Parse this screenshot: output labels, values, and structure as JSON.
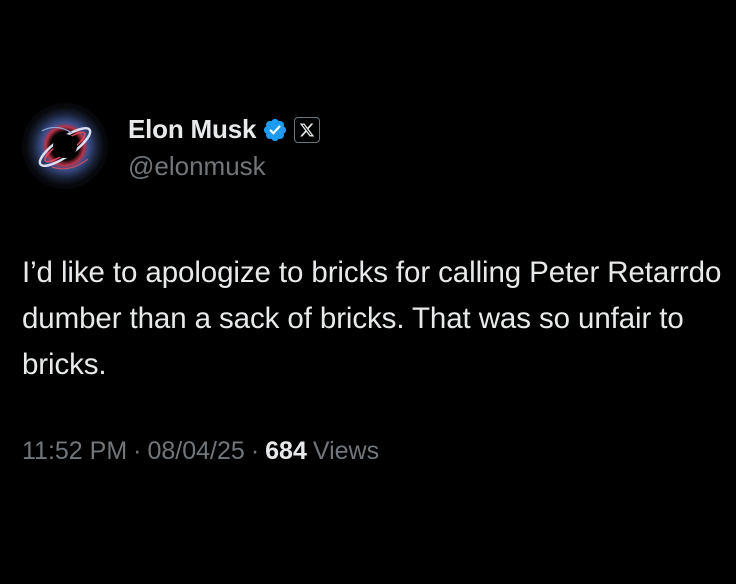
{
  "author": {
    "display_name": "Elon Musk",
    "handle": "@elonmusk",
    "verified": true,
    "verified_badge_color": "#1d9bf0",
    "affiliation_icon": "x-logo-icon",
    "avatar": "black-hole-avatar"
  },
  "post": {
    "text": "I’d like to apologize to bricks for calling Peter Retarrdo dumber than a sack of bricks. That was so unfair to bricks."
  },
  "meta": {
    "time": "11:52 PM",
    "separator": "·",
    "date": "08/04/25",
    "views_count": "684",
    "views_label": "Views"
  },
  "colors": {
    "background": "#000000",
    "primary_text": "#e7e9ea",
    "secondary_text": "#71767b"
  }
}
